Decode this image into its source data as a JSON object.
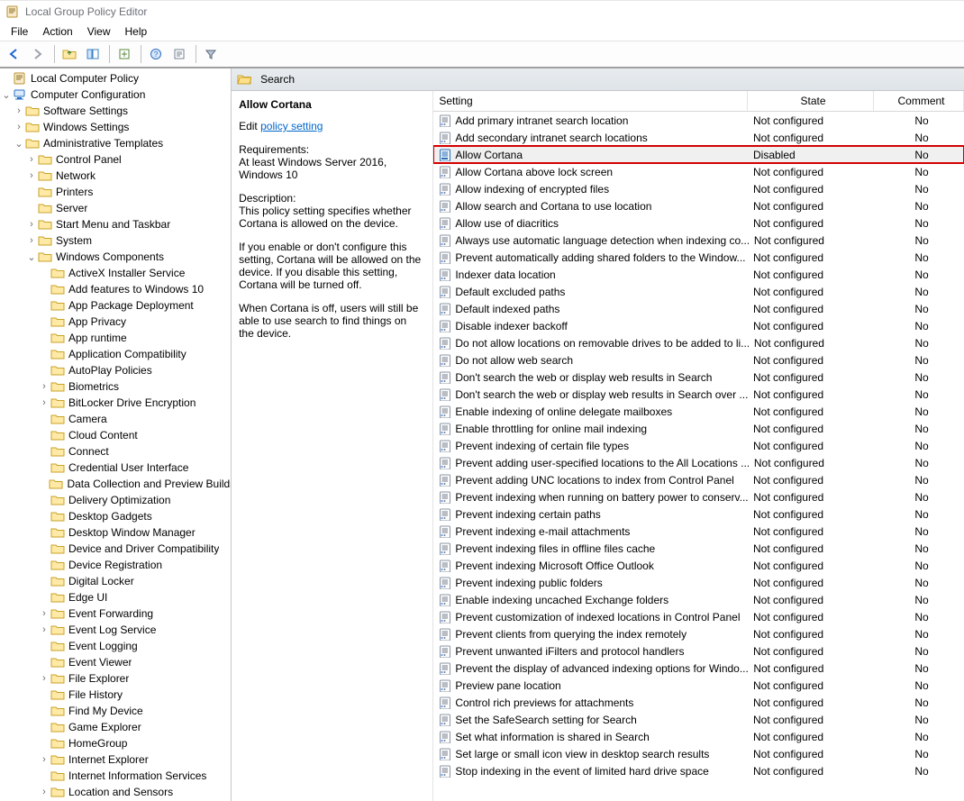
{
  "window": {
    "title": "Local Group Policy Editor"
  },
  "menu": {
    "file": "File",
    "action": "Action",
    "view": "View",
    "help": "Help"
  },
  "tree": {
    "root": "Local Computer Policy",
    "cc": "Computer Configuration",
    "ss": "Software Settings",
    "ws": "Windows Settings",
    "at": "Administrative Templates",
    "cp": "Control Panel",
    "net": "Network",
    "prn": "Printers",
    "srv": "Server",
    "start": "Start Menu and Taskbar",
    "sys": "System",
    "wc": "Windows Components",
    "items": [
      "ActiveX Installer Service",
      "Add features to Windows 10",
      "App Package Deployment",
      "App Privacy",
      "App runtime",
      "Application Compatibility",
      "AutoPlay Policies",
      "Biometrics",
      "BitLocker Drive Encryption",
      "Camera",
      "Cloud Content",
      "Connect",
      "Credential User Interface",
      "Data Collection and Preview Builds",
      "Delivery Optimization",
      "Desktop Gadgets",
      "Desktop Window Manager",
      "Device and Driver Compatibility",
      "Device Registration",
      "Digital Locker",
      "Edge UI",
      "Event Forwarding",
      "Event Log Service",
      "Event Logging",
      "Event Viewer",
      "File Explorer",
      "File History",
      "Find My Device",
      "Game Explorer",
      "HomeGroup",
      "Internet Explorer",
      "Internet Information Services",
      "Location and Sensors"
    ],
    "expandable_idx": [
      7,
      8,
      21,
      22,
      25,
      30,
      32
    ]
  },
  "category": {
    "name": "Search"
  },
  "desc": {
    "selected_title": "Allow Cortana",
    "edit_prefix": "Edit ",
    "edit_link": "policy setting",
    "req_label": "Requirements:",
    "req_text": "At least Windows Server 2016, Windows 10",
    "desc_label": "Description:",
    "desc_text1": "This policy setting specifies whether Cortana is allowed on the device.",
    "desc_text2": "If you enable or don't configure this setting, Cortana will be allowed on the device. If you disable this setting, Cortana will be turned off.",
    "desc_text3": "When Cortana is off, users will still be able to use search to find things on the device."
  },
  "columns": {
    "setting": "Setting",
    "state": "State",
    "comment": "Comment"
  },
  "defaults": {
    "state_nc": "Not configured",
    "state_disabled": "Disabled",
    "comment_no": "No"
  },
  "settings": [
    {
      "name": "Add primary intranet search location"
    },
    {
      "name": "Add secondary intranet search locations"
    },
    {
      "name": "Allow Cortana",
      "state": "Disabled",
      "selected": true
    },
    {
      "name": "Allow Cortana above lock screen"
    },
    {
      "name": "Allow indexing of encrypted files"
    },
    {
      "name": "Allow search and Cortana to use location"
    },
    {
      "name": "Allow use of diacritics"
    },
    {
      "name": "Always use automatic language detection when indexing co..."
    },
    {
      "name": "Prevent automatically adding shared folders to the Window..."
    },
    {
      "name": "Indexer data location"
    },
    {
      "name": "Default excluded paths"
    },
    {
      "name": "Default indexed paths"
    },
    {
      "name": "Disable indexer backoff"
    },
    {
      "name": "Do not allow locations on removable drives to be added to li..."
    },
    {
      "name": "Do not allow web search"
    },
    {
      "name": "Don't search the web or display web results in Search"
    },
    {
      "name": "Don't search the web or display web results in Search over ..."
    },
    {
      "name": "Enable indexing of online delegate mailboxes"
    },
    {
      "name": "Enable throttling for online mail indexing"
    },
    {
      "name": "Prevent indexing of certain file types"
    },
    {
      "name": "Prevent adding user-specified locations to the All Locations ..."
    },
    {
      "name": "Prevent adding UNC locations to index from Control Panel"
    },
    {
      "name": "Prevent indexing when running on battery power to conserv..."
    },
    {
      "name": "Prevent indexing certain paths"
    },
    {
      "name": "Prevent indexing e-mail attachments"
    },
    {
      "name": "Prevent indexing files in offline files cache"
    },
    {
      "name": "Prevent indexing Microsoft Office Outlook"
    },
    {
      "name": "Prevent indexing public folders"
    },
    {
      "name": "Enable indexing uncached Exchange folders"
    },
    {
      "name": "Prevent customization of indexed locations in Control Panel"
    },
    {
      "name": "Prevent clients from querying the index remotely"
    },
    {
      "name": "Prevent unwanted iFilters and protocol handlers"
    },
    {
      "name": "Prevent the display of advanced indexing options for Windo..."
    },
    {
      "name": "Preview pane location"
    },
    {
      "name": "Control rich previews for attachments"
    },
    {
      "name": "Set the SafeSearch setting for Search"
    },
    {
      "name": "Set what information is shared in Search"
    },
    {
      "name": "Set large or small icon view in desktop search results"
    },
    {
      "name": "Stop indexing in the event of limited hard drive space"
    }
  ]
}
